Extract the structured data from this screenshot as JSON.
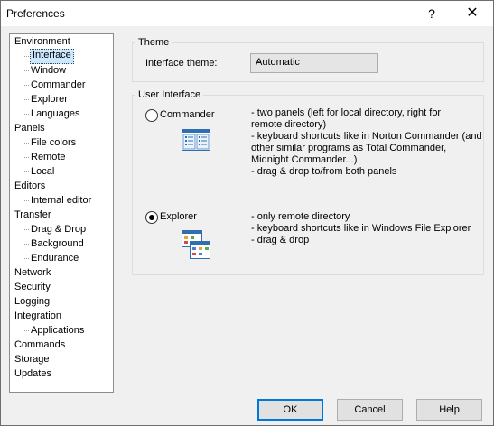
{
  "window": {
    "title": "Preferences",
    "help": "?",
    "close": "✕"
  },
  "tree": {
    "items": [
      {
        "label": "Environment",
        "level": 0
      },
      {
        "label": "Interface",
        "level": 1,
        "selected": true
      },
      {
        "label": "Window",
        "level": 1
      },
      {
        "label": "Commander",
        "level": 1
      },
      {
        "label": "Explorer",
        "level": 1
      },
      {
        "label": "Languages",
        "level": 1
      },
      {
        "label": "Panels",
        "level": 0
      },
      {
        "label": "File colors",
        "level": 1
      },
      {
        "label": "Remote",
        "level": 1
      },
      {
        "label": "Local",
        "level": 1
      },
      {
        "label": "Editors",
        "level": 0
      },
      {
        "label": "Internal editor",
        "level": 1
      },
      {
        "label": "Transfer",
        "level": 0
      },
      {
        "label": "Drag & Drop",
        "level": 1
      },
      {
        "label": "Background",
        "level": 1
      },
      {
        "label": "Endurance",
        "level": 1
      },
      {
        "label": "Network",
        "level": 0
      },
      {
        "label": "Security",
        "level": 0
      },
      {
        "label": "Logging",
        "level": 0
      },
      {
        "label": "Integration",
        "level": 0
      },
      {
        "label": "Applications",
        "level": 1
      },
      {
        "label": "Commands",
        "level": 0
      },
      {
        "label": "Storage",
        "level": 0
      },
      {
        "label": "Updates",
        "level": 0
      }
    ]
  },
  "theme": {
    "group_title": "Theme",
    "label": "Interface theme:",
    "value": "Automatic"
  },
  "ui": {
    "group_title": "User Interface",
    "commander": {
      "label": "Commander",
      "selected": false,
      "desc": [
        "- two panels (left for local directory, right for",
        "remote directory)",
        "- keyboard shortcuts like in Norton Commander (and",
        "other similar programs as Total Commander,",
        "Midnight Commander...)",
        "- drag & drop to/from both panels"
      ]
    },
    "explorer": {
      "label": "Explorer",
      "selected": true,
      "desc": [
        "- only remote directory",
        "- keyboard shortcuts like in Windows File Explorer",
        "- drag & drop"
      ]
    }
  },
  "buttons": {
    "ok": "OK",
    "cancel": "Cancel",
    "help": "Help"
  },
  "colors": {
    "accent": "#0078d7",
    "selection": "#cce8ff"
  }
}
